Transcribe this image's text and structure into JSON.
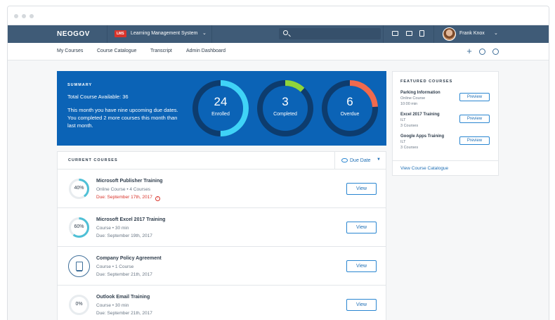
{
  "header": {
    "brand": "NEOGOV",
    "app_badge": "LMS",
    "app_title": "Learning Management System",
    "user_name": "Frank Knox"
  },
  "subnav": {
    "items": [
      "My Courses",
      "Course Catalogue",
      "Transcript",
      "Admin Dashboard"
    ]
  },
  "summary": {
    "label": "SUMMARY",
    "total": "Total Course Available: 36",
    "description": "This month you have nine upcoming due dates.  You completed 2 more courses this month than last month.",
    "stats": [
      {
        "value": "24",
        "label": "Enrolled",
        "fraction": 0.5,
        "color": "#3fd3f7"
      },
      {
        "value": "3",
        "label": "Completed",
        "fraction": 0.12,
        "color": "#8fd43a"
      },
      {
        "value": "6",
        "label": "Overdue",
        "fraction": 0.24,
        "color": "#f06a4e"
      }
    ]
  },
  "current_courses": {
    "label": "CURRENT COURSES",
    "sort_label": "Due Date",
    "rows": [
      {
        "progress": "40%",
        "title": "Microsoft Publisher Training",
        "meta": "Online Course  •  4 Courses",
        "due": "Due: September 17th, 2017",
        "late": true,
        "button": "View"
      },
      {
        "progress": "60%",
        "title": "Microsoft Excel 2017 Training",
        "meta": "Course  •  30 min",
        "due": "Due: September 19th, 2017",
        "late": false,
        "button": "View"
      },
      {
        "progress": "",
        "title": "Company Policy Agreement",
        "meta": "Course  •  1 Course",
        "due": "Due: September 21th, 2017",
        "late": false,
        "button": "View"
      },
      {
        "progress": "0%",
        "title": "Outlook Email Training",
        "meta": "Course  •  30 min",
        "due": "Due: September 21th, 2017",
        "late": false,
        "button": "View"
      }
    ]
  },
  "featured": {
    "label": "FEATURED COURSES",
    "items": [
      {
        "name": "Parking Information",
        "meta1": "Online Course",
        "meta2": "10:00 min",
        "button": "Preview"
      },
      {
        "name": "Excel 2017 Training",
        "meta1": "ILT",
        "meta2": "3 Courses",
        "button": "Preview"
      },
      {
        "name": "Google Apps Training",
        "meta1": "ILT",
        "meta2": "3 Courses",
        "button": "Preview"
      }
    ],
    "footer_link": "View Course Catalogue"
  },
  "colors": {
    "topbar": "#3f5b77",
    "summary_bg": "#0b63b6",
    "accent": "#2a86d1",
    "late": "#d9342b",
    "progress": "#4ec0d6"
  }
}
